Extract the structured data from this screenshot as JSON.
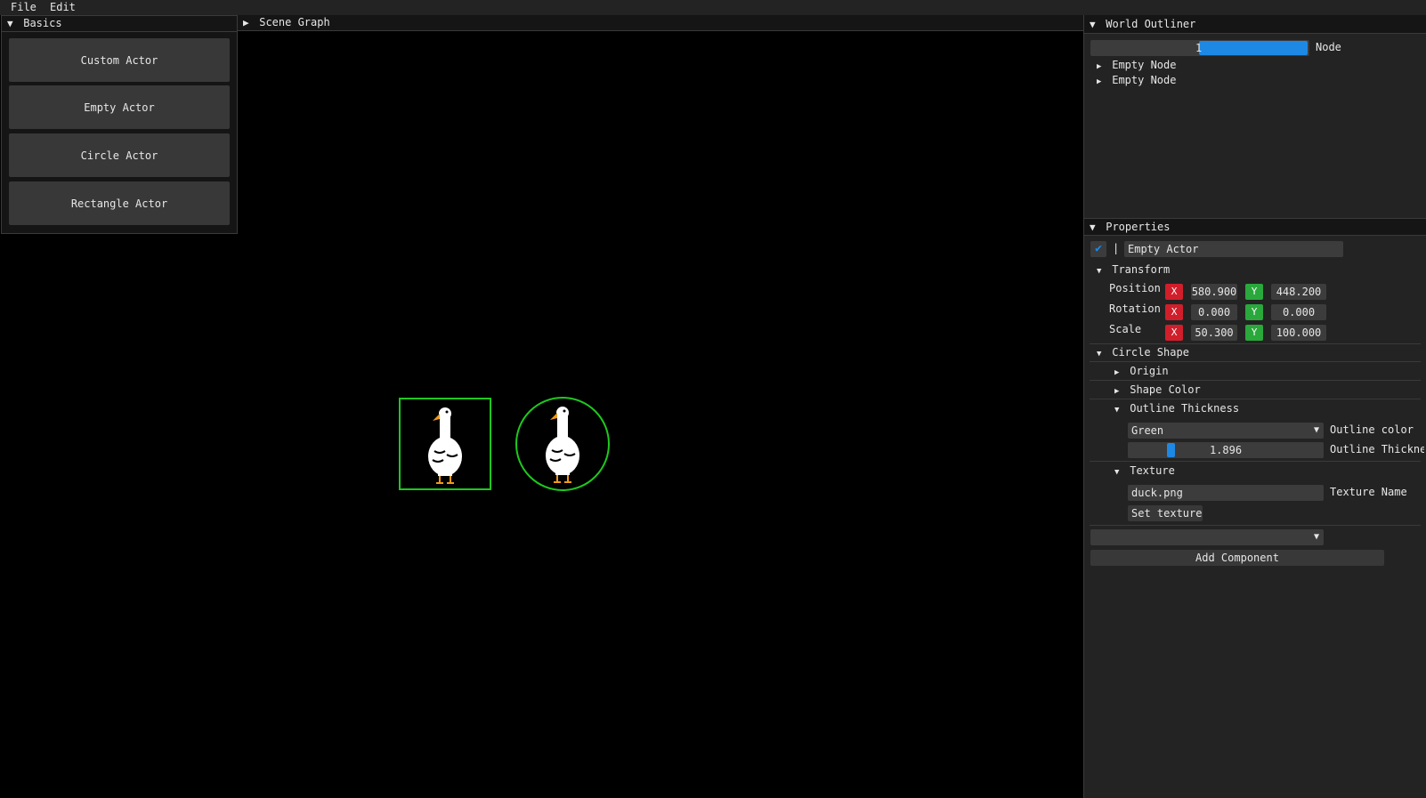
{
  "menu": {
    "file": "File",
    "edit": "Edit"
  },
  "basics": {
    "title": "Basics",
    "buttons": [
      "Custom Actor",
      "Empty Actor",
      "Circle Actor",
      "Rectangle Actor"
    ]
  },
  "scene_graph": {
    "title": "Scene Graph"
  },
  "outliner": {
    "title": "World Outliner",
    "input_value": "1",
    "input_label": "Node",
    "nodes": [
      "Empty Node",
      "Empty Node"
    ]
  },
  "properties": {
    "title": "Properties",
    "actor_name": "Empty Actor",
    "enabled_separator": "|",
    "transform": {
      "title": "Transform",
      "position": {
        "label": "Position",
        "x": "580.900",
        "y": "448.200"
      },
      "rotation": {
        "label": "Rotation",
        "x": "0.000",
        "y": "0.000"
      },
      "scale": {
        "label": "Scale",
        "x": "50.300",
        "y": "100.000"
      },
      "x_label": "X",
      "y_label": "Y"
    },
    "circle_shape": {
      "title": "Circle Shape",
      "origin": "Origin",
      "shape_color": "Shape Color",
      "outline_thickness": "Outline Thickness",
      "outline_color_value": "Green",
      "outline_color_label": "Outline color",
      "outline_thickness_value": "1.896",
      "outline_thickness_label": "Outline Thickness",
      "texture": "Texture",
      "texture_name_value": "duck.png",
      "texture_name_label": "Texture Name",
      "set_texture": "Set texture"
    },
    "component_select": "",
    "add_component": "Add Component"
  },
  "colors": {
    "accent": "#1e88e5",
    "outline_green": "#1ec81e",
    "x_red": "#d01f2b",
    "y_green": "#2aa83c"
  }
}
